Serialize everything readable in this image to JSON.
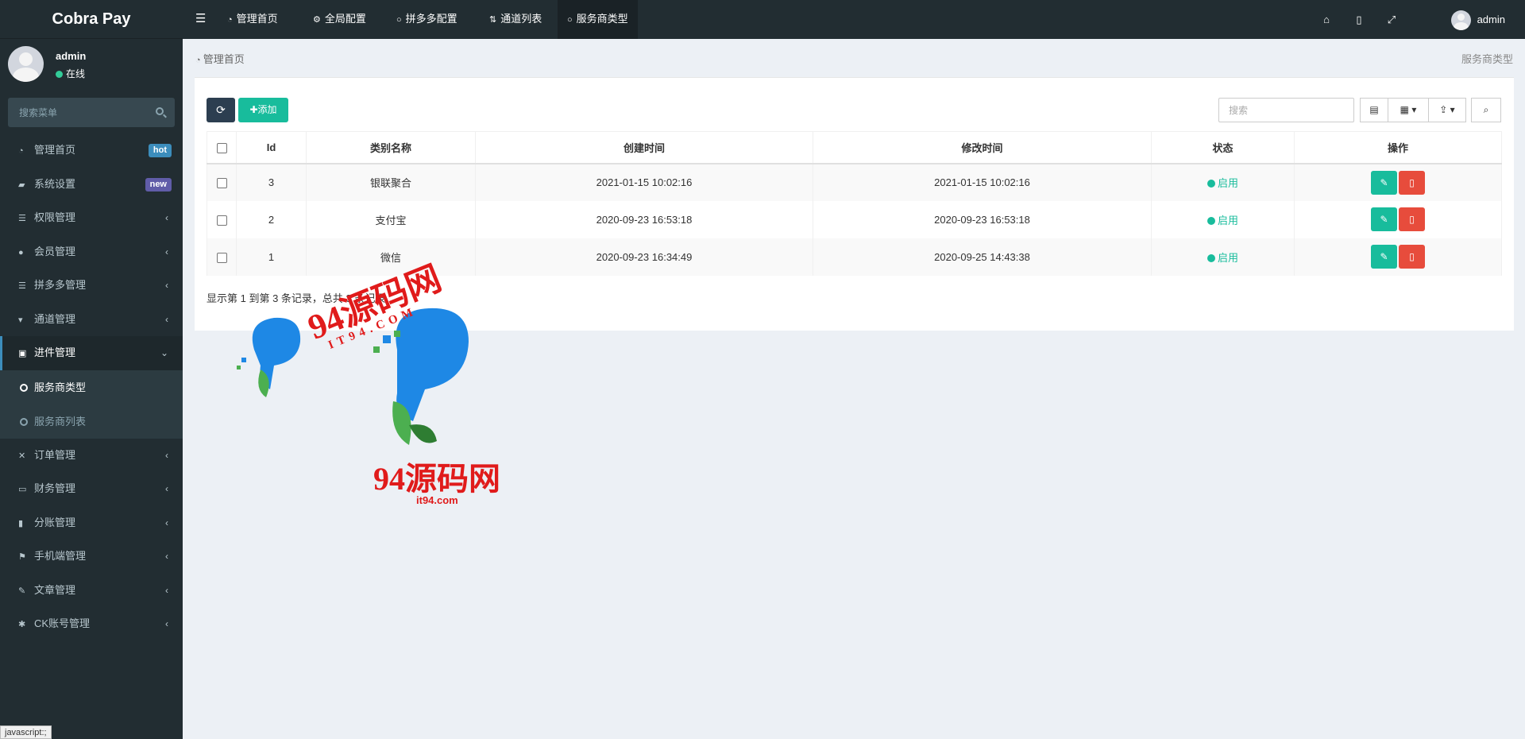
{
  "app": {
    "title": "Cobra Pay"
  },
  "user": {
    "name": "admin",
    "status": "在线"
  },
  "sidebar": {
    "search_placeholder": "搜索菜单",
    "items": [
      {
        "label": "管理首页",
        "badge": "hot"
      },
      {
        "label": "系统设置",
        "badge": "new"
      },
      {
        "label": "权限管理"
      },
      {
        "label": "会员管理"
      },
      {
        "label": "拼多多管理"
      },
      {
        "label": "通道管理"
      },
      {
        "label": "进件管理"
      },
      {
        "label": "订单管理"
      },
      {
        "label": "财务管理"
      },
      {
        "label": "分账管理"
      },
      {
        "label": "手机端管理"
      },
      {
        "label": "文章管理"
      },
      {
        "label": "CK账号管理"
      }
    ],
    "subitems": [
      {
        "label": "服务商类型"
      },
      {
        "label": "服务商列表"
      }
    ]
  },
  "navbar": {
    "tabs": [
      {
        "label": "管理首页"
      },
      {
        "label": "全局配置"
      },
      {
        "label": "拼多多配置"
      },
      {
        "label": "通道列表"
      },
      {
        "label": "服务商类型"
      }
    ],
    "user": "admin"
  },
  "breadcrumb": {
    "left": "管理首页",
    "right": "服务商类型"
  },
  "toolbar": {
    "add_label": "添加",
    "search_placeholder": "搜索"
  },
  "table": {
    "headers": [
      "Id",
      "类别名称",
      "创建时间",
      "修改时间",
      "状态",
      "操作"
    ],
    "rows": [
      {
        "id": "3",
        "name": "银联聚合",
        "created": "2021-01-15 10:02:16",
        "modified": "2021-01-15 10:02:16",
        "status": "启用"
      },
      {
        "id": "2",
        "name": "支付宝",
        "created": "2020-09-23 16:53:18",
        "modified": "2020-09-23 16:53:18",
        "status": "启用"
      },
      {
        "id": "1",
        "name": "微信",
        "created": "2020-09-23 16:34:49",
        "modified": "2020-09-25 14:43:38",
        "status": "启用"
      }
    ],
    "summary": "显示第 1 到第 3 条记录，总共 3 条记录"
  },
  "watermark": {
    "text1": "94源码网",
    "text2": "IT94.COM",
    "text3": "94源码网",
    "text4": "it94.com"
  },
  "statusbar": {
    "text": "javascript:;"
  },
  "colors": {
    "sidebar_bg": "#222d32",
    "accent": "#18bc9c",
    "danger": "#e74c3c",
    "dark_btn": "#2c3e50"
  }
}
